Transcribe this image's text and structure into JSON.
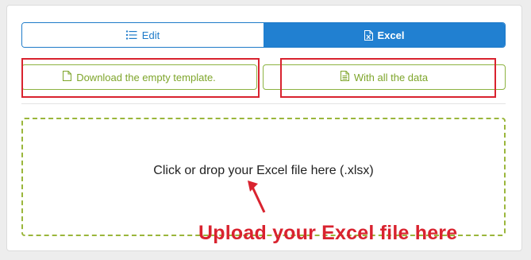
{
  "tabs": {
    "edit_label": "Edit",
    "edit_icon": "list-icon",
    "excel_label": "Excel",
    "excel_icon": "excel-file-icon",
    "active": "Excel"
  },
  "downloads": {
    "template_label": "Download the empty template.",
    "template_icon": "file-icon",
    "all_data_label": "With all the data",
    "all_data_icon": "file-text-icon"
  },
  "dropzone": {
    "text": "Click or drop your Excel file here (.xlsx)"
  },
  "annotation": {
    "text": "Upload your Excel file here"
  },
  "colors": {
    "primary_blue": "#2180d1",
    "green": "#8db341",
    "annotation_red": "#d9232f"
  }
}
